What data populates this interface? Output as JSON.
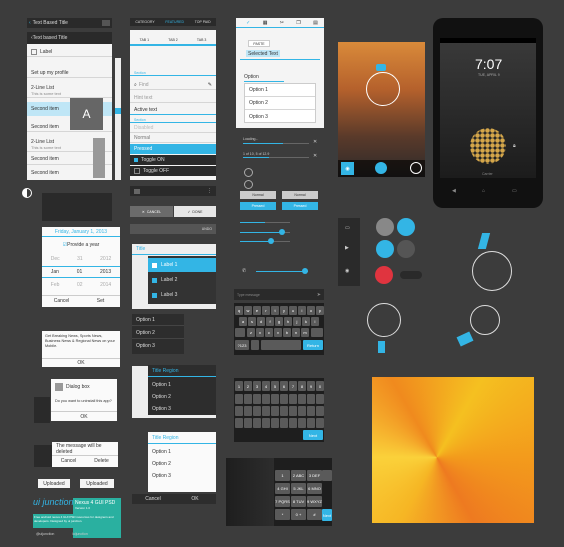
{
  "list_panel": {
    "top_bar": "Text Based Title",
    "sub_title": "Text based Title",
    "label": "Label",
    "profile": "Set up my profile",
    "items": [
      {
        "title": "2-Line List",
        "sub": "This is some text"
      },
      {
        "title": "Second item"
      },
      {
        "title": "Second item"
      },
      {
        "title": "2-Line List",
        "sub": "This is some text"
      },
      {
        "title": "Second item"
      },
      {
        "title": "Second item"
      }
    ],
    "avatar_letter": "A"
  },
  "tabs_panel": {
    "top_tabs": [
      "CATEGORY",
      "FEATURED",
      "TOP PAID"
    ],
    "tabs": [
      "TAB 1",
      "TAB 2",
      "TAB 3"
    ],
    "section1": "Section",
    "find_placeholder": "Find",
    "hint": "Hint text",
    "active": "Active text",
    "section2": "Section",
    "disabled": "Disabled",
    "normal": "Normal",
    "pressed": "Pressed",
    "toggle_on": "Toggle ON",
    "toggle_off": "Toggle OFF"
  },
  "dialog_panel": {
    "paste": "PASTE",
    "selected": "Selected Text",
    "input": "Option",
    "options": [
      "Option 1",
      "Option 2",
      "Option 3"
    ]
  },
  "controls": {
    "loading": "Loading...",
    "progress": "1 of 10, 5 of 12.9",
    "normal": "Normal",
    "pressed": "Pressed",
    "cancel": "CANCEL",
    "done": "DONE",
    "undo": "UNDO"
  },
  "phone": {
    "time": "7:07",
    "date": "TUE, APRIL 9",
    "carrier": "Carrier"
  },
  "date_picker": {
    "header": "Friday, January 1, 2013",
    "checkbox": "Provide a year",
    "rows": [
      [
        "Dec",
        "31",
        "2012"
      ],
      [
        "Jan",
        "01",
        "2013"
      ],
      [
        "Feb",
        "02",
        "2014"
      ]
    ],
    "cancel": "Cancel",
    "set": "Set"
  },
  "label_list": {
    "title": "Title",
    "labels": [
      "Label 1",
      "Label 2",
      "Label 3"
    ]
  },
  "notifications": {
    "message": "Get Breaking News, Sports News, Business News & Regional News on your Mobile.",
    "ok": "OK",
    "dialog_title": "Dialog box",
    "uninstall": "Do you want to uninstall this app?",
    "ok2": "OK",
    "cancel": "Cancel",
    "uploaded": "Uploaded",
    "uploaded2": "Uploaded",
    "deleted": "The message will be deleted",
    "cancel2": "Cancel",
    "delete": "Delete"
  },
  "option_lists": {
    "opts": [
      "Option 1",
      "Option 2",
      "Option 3"
    ],
    "region_title": "Title Region",
    "region_opts": [
      "Option 1",
      "Option 2",
      "Option 3"
    ],
    "region2_title": "Title Region",
    "region2_opts": [
      "Option 1",
      "Option 2",
      "Option 3"
    ],
    "cancel": "Cancel",
    "ok": "OK"
  },
  "keyboard": {
    "input_placeholder": "Type message",
    "row1": [
      "q",
      "w",
      "e",
      "r",
      "t",
      "y",
      "u",
      "i",
      "o",
      "p"
    ],
    "row2": [
      "a",
      "s",
      "d",
      "f",
      "g",
      "h",
      "j",
      "k",
      "l"
    ],
    "row3": [
      "z",
      "x",
      "c",
      "v",
      "b",
      "n",
      "m"
    ],
    "num_row1": [
      "1",
      "2",
      "3",
      "4",
      "5",
      "6",
      "7",
      "8",
      "9",
      "0"
    ],
    "dial": [
      [
        "1",
        "2 ABC",
        "3 DEF"
      ],
      [
        "4 GHI",
        "5 JKL",
        "6 MNO"
      ],
      [
        "7 PQRS",
        "8 TUV",
        "9 WXYZ"
      ],
      [
        "*",
        "0 +",
        "#"
      ]
    ],
    "return": "Return",
    "next": "Next",
    "symbols": "?123"
  },
  "credits": {
    "logo": "ui junction",
    "title": "Nexus 4 GUI PSD",
    "version": "Version 1.0",
    "desc": "Free android nexus 4 GUI PSD resources for designers and developers. Designed by ui junction.",
    "twitter": "@uijunction",
    "dribbble": "/uijunction"
  },
  "colors": {
    "accent": "#33b5e5",
    "dark": "#2a2a2a",
    "light": "#f4f4f4",
    "bg": "#3c3c3c",
    "red": "#e0343f"
  }
}
